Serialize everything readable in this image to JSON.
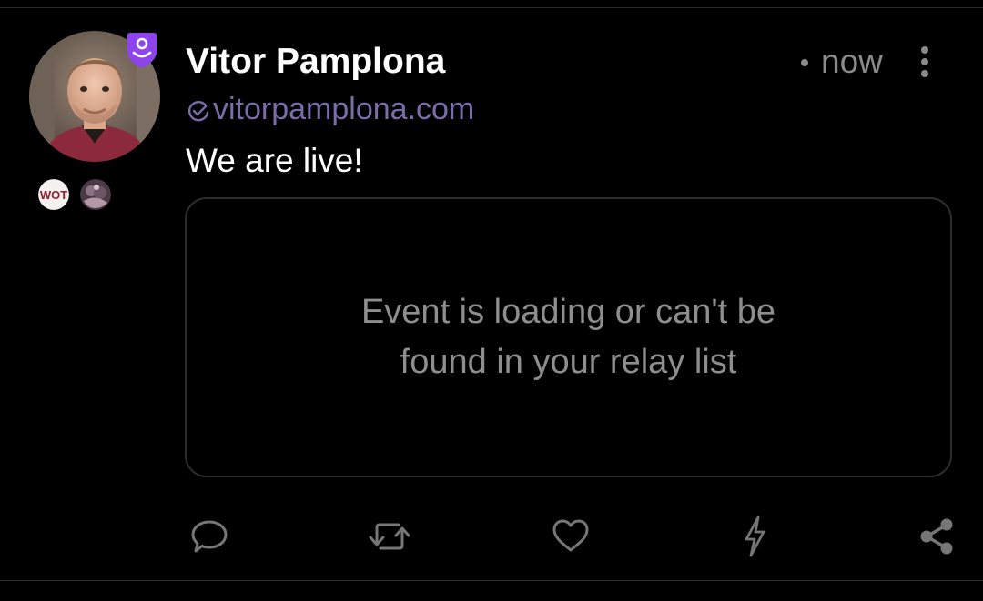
{
  "post": {
    "author_name": "Vitor Pamplona",
    "nip05": "vitorpamplona.com",
    "timestamp": "now",
    "content": "We are live!"
  },
  "embed": {
    "message": "Event is loading or can't be found in your relay list"
  },
  "badges": {
    "wot_label": "WOT"
  },
  "actions": [
    "reply",
    "repost",
    "like",
    "zap",
    "share"
  ],
  "icons": {
    "verified": "shield-user-icon",
    "nip05": "check-circle-icon",
    "more": "vertical-dots-icon",
    "reply": "speech-bubble-icon",
    "repost": "repeat-icon",
    "like": "heart-icon",
    "zap": "lightning-icon",
    "share": "share-icon"
  },
  "colors": {
    "background": "#000000",
    "accent": "#8e44ec",
    "nip05": "#7b6ba8",
    "muted": "#8a8a8a",
    "icon": "#767676",
    "border": "#2d2d2d"
  }
}
